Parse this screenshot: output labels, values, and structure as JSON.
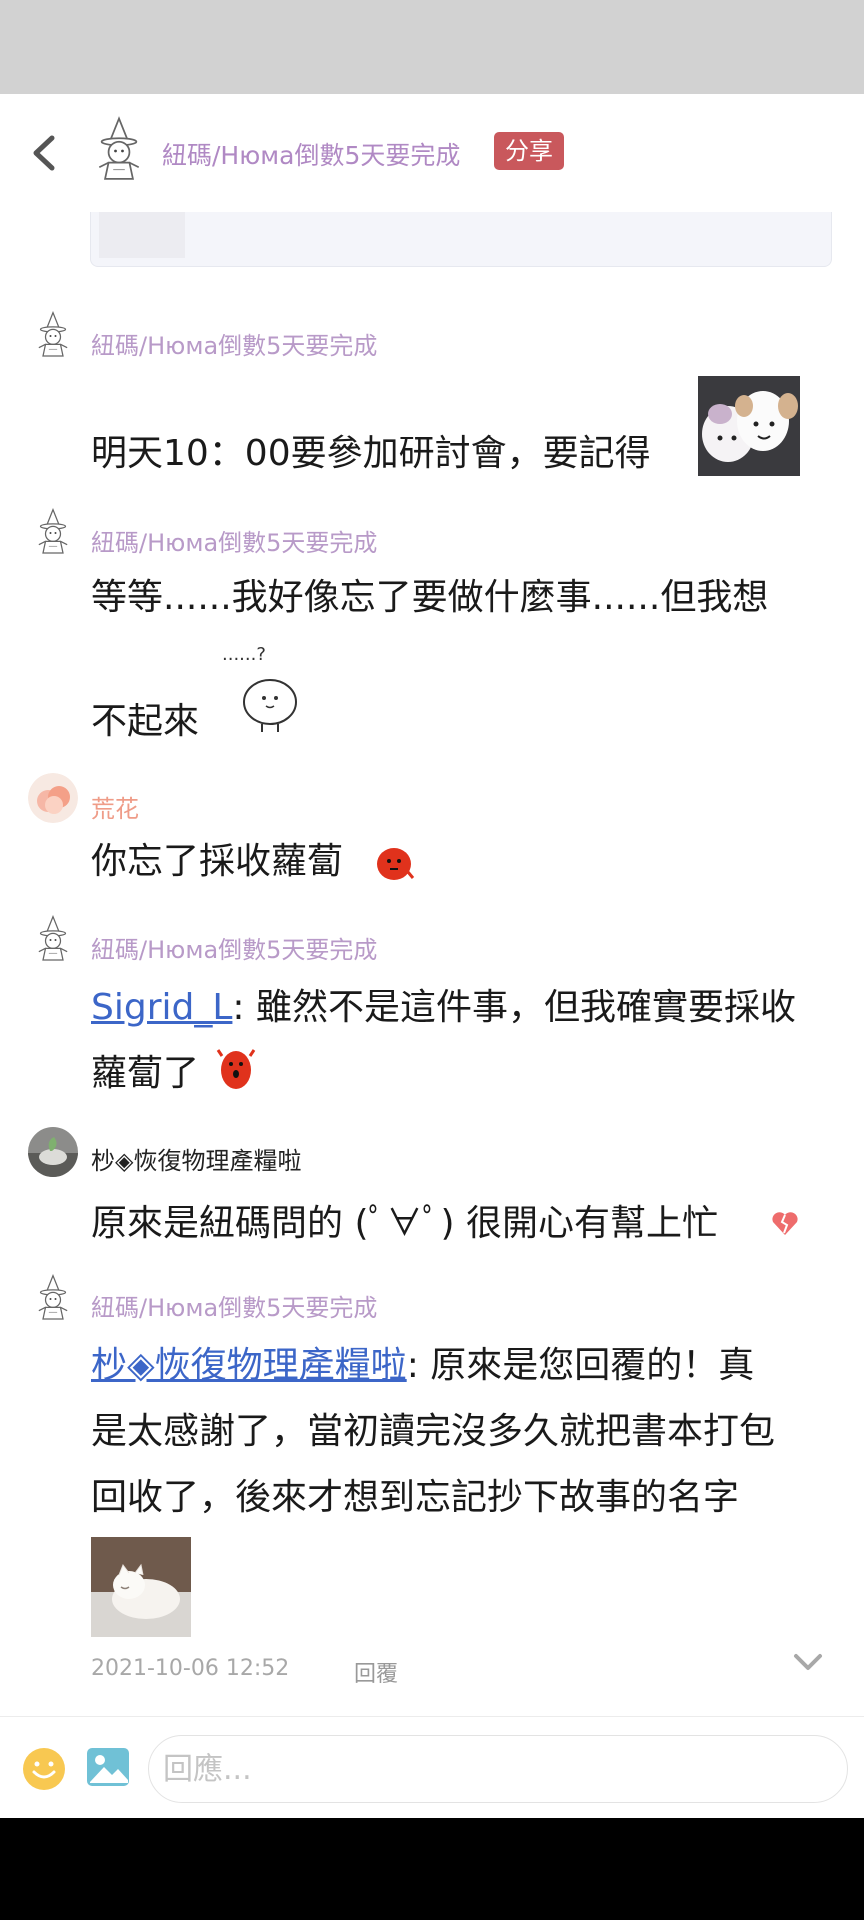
{
  "header": {
    "title": "紐碼/Нюма倒數5天要完成",
    "badge": "分享"
  },
  "messages": [
    {
      "author": "紐碼/Нюма倒數5天要完成",
      "text": "明天10：00要參加研討會，要記得",
      "sticker": "two-sheep-sticker"
    },
    {
      "author": "紐碼/Нюма倒數5天要完成",
      "line1": "等等......我好像忘了要做什麼事......但我想",
      "line2": "不起來",
      "sticker": "confused-chick-sticker",
      "sticker_text": "......?"
    },
    {
      "author": "荒花",
      "text": "你忘了採收蘿蔔",
      "emoji": "red-blob-emoji"
    },
    {
      "author": "紐碼/Нюма倒數5天要完成",
      "mention": "Sigrid_L",
      "line1_rest": ": 雖然不是這件事，但我確實要採收",
      "line2": "蘿蔔了",
      "emoji": "red-blob-emoji"
    },
    {
      "author": "杪◈恢復物理產糧啦",
      "text": "原來是紐碼問的 (ﾟ∀ﾟ) 很開心有幫上忙",
      "emoji": "broken-heart-emoji"
    },
    {
      "author": "紐碼/Нюма倒數5天要完成",
      "mention": "杪◈恢復物理產糧啦",
      "line1_rest": ": 原來是您回覆的！真",
      "line2": "是太感謝了，當初讀完沒多久就把書本打包",
      "line3": "回收了，後來才想到忘記抄下故事的名字",
      "image": "white-cat-photo"
    }
  ],
  "footer": {
    "timestamp": "2021-10-06 12:52",
    "reply_label": "回覆",
    "expand_icon": "chevron-down-icon"
  },
  "compose": {
    "placeholder": "回應..."
  },
  "icons": {
    "back": "chevron-left-icon",
    "emoji": "smiley-icon",
    "image": "image-icon"
  },
  "colors": {
    "author_purple": "#b89ac8",
    "author_orange": "#ef9c88",
    "badge_red": "#c9585c",
    "mention_blue": "#3c66c8",
    "status_bar": "#d2d2d2"
  }
}
